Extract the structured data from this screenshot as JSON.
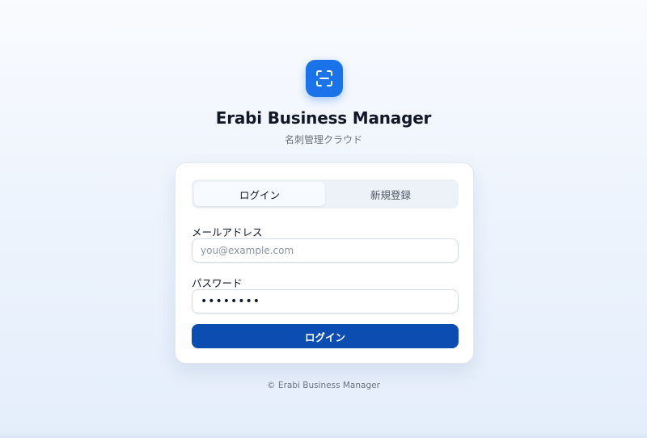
{
  "brand": {
    "logo_icon": "scan-icon",
    "title": "Erabi Business Manager",
    "subtitle": "名刺管理クラウド",
    "accent_color": "#1a73e8"
  },
  "auth": {
    "tabs": [
      {
        "label": "ログイン",
        "active": true
      },
      {
        "label": "新規登録",
        "active": false
      }
    ],
    "email": {
      "label": "メールアドレス",
      "placeholder": "you@example.com",
      "value": ""
    },
    "password": {
      "label": "パスワード",
      "value": "password"
    },
    "submit_label": "ログイン",
    "submit_color": "#0b4db1"
  },
  "footer": {
    "text": "© Erabi Business Manager"
  }
}
